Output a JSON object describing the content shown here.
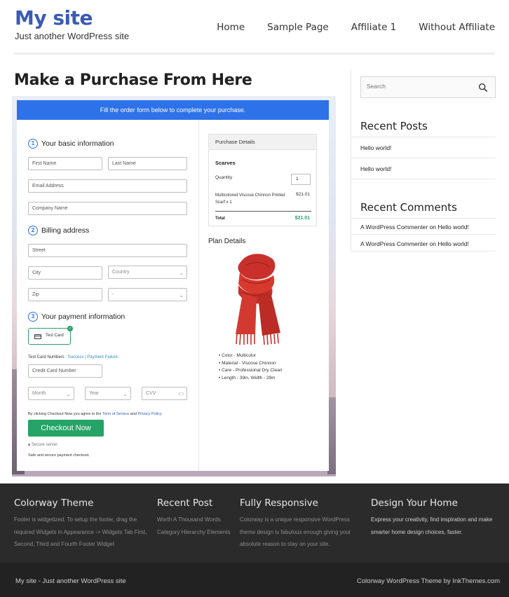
{
  "header": {
    "site_title": "My site",
    "tagline": "Just another WordPress site",
    "nav": [
      "Home",
      "Sample Page",
      "Affiliate 1",
      "Without Affiliate"
    ]
  },
  "page": {
    "title": "Make a Purchase From Here"
  },
  "checkout": {
    "banner": "Fill the order form below to complete your purchase.",
    "step1": {
      "num": "1",
      "label": "Your basic information"
    },
    "first_name": "First Name",
    "last_name": "Last Name",
    "email": "Email Address",
    "company": "Company Name",
    "step2": {
      "num": "2",
      "label": "Billing address"
    },
    "street": "Street",
    "city": "City",
    "country": "Country",
    "zip": "Zip",
    "state": "-",
    "step3": {
      "num": "3",
      "label": "Your payment information"
    },
    "card_label": "Test Card",
    "test_numbers_label": "Test Card Numbers : ",
    "success_link": "Success",
    "separator": " | ",
    "failure_link": "Payment Failure",
    "card_number": "Credit Card Number",
    "month": "Month",
    "year": "Year",
    "cvv": "CVV",
    "agree_prefix": "By clicking Checkout Now you agree to the ",
    "terms": "Term of Service",
    "agree_and": " and ",
    "privacy": "Privacy Policy",
    "button": "Checkout Now",
    "secure": "Secure server",
    "safe": "Safe and secure payment checkout."
  },
  "purchase_details": {
    "heading": "Purchase Details",
    "product": "Scarves",
    "quantity_label": "Quantity",
    "quantity": "1",
    "item": "Multicolored Viscose Chinnon Printed Scarf x 1",
    "price": "$21.01",
    "total_label": "Total",
    "total": "$21.01"
  },
  "plan": {
    "title": "Plan Details",
    "features": [
      "Color - Multicolor",
      "Material - Viscose Chinnon",
      "Care - Professional Dry Clean",
      "Length - 39in, Width - 39in"
    ]
  },
  "sidebar": {
    "search_placeholder": "Search",
    "recent_posts_title": "Recent Posts",
    "recent_posts": [
      "Hello world!",
      "Hello world!"
    ],
    "recent_comments_title": "Recent Comments",
    "recent_comments": [
      "A WordPress Commenter on Hello world!",
      "A WordPress Commenter on Hello world!"
    ]
  },
  "footer": {
    "col1": {
      "title": "Colorway Theme",
      "text": "Footer is widgetized. To setup the footer, drag the required Widgets in Appearance -> Widgets Tab First, Second, Third and Fourth Footer Widget"
    },
    "col2": {
      "title": "Recent Post",
      "text": "Worth A Thousand Words Category Hierarchy Elements"
    },
    "col3": {
      "title": "Fully Responsive",
      "text": "Colorway is a unique responsive WordPress theme design is fabulous enough giving your absolute reason to stay on your site."
    },
    "col4": {
      "title": "Design Your Home",
      "text": "Express your creativity, find inspiration and make smarter home design choices, faster."
    },
    "bottom_left": "My site - Just another WordPress site",
    "bottom_right": "Colorway WordPress Theme by InkThemes.com"
  },
  "colors": {
    "brand": "#3b5bb3",
    "accent": "#2d72e8",
    "success": "#26a367"
  }
}
